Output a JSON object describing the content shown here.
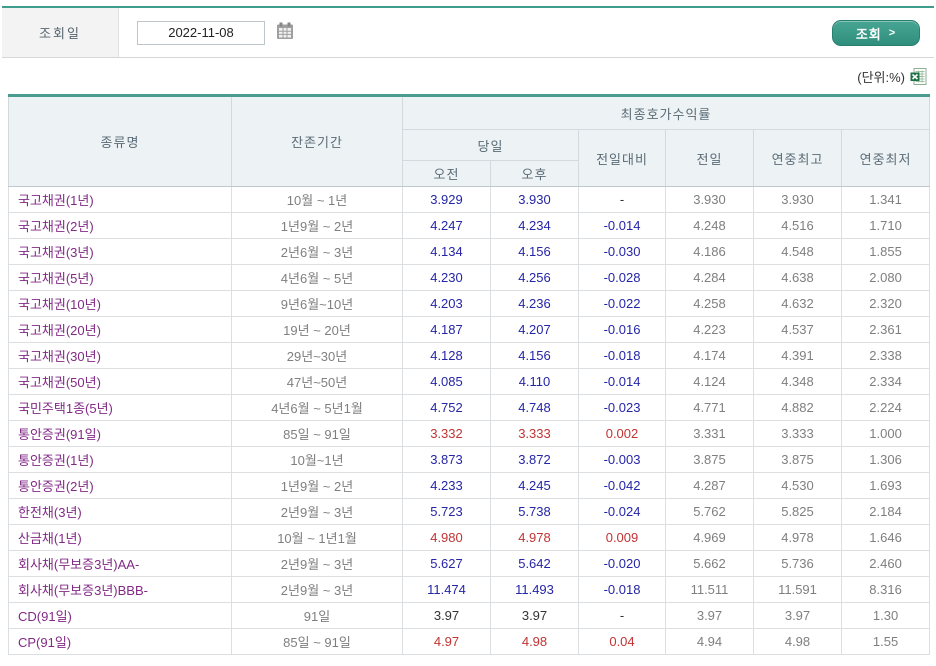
{
  "topbar": {
    "date_label": "조회일",
    "date_value": "2022-11-08",
    "search_button_label": "조회",
    "search_button_chevron": ">"
  },
  "unit_label": "(단위:%)",
  "icons": {
    "calendar": "calendar-icon",
    "excel_export": "excel-icon"
  },
  "colors": {
    "accent_teal": "#3E9D8D",
    "header_bg": "#EDF3F5",
    "name_purple": "#822A86",
    "value_down_blue": "#2525A8",
    "value_up_red": "#C23333",
    "value_gray": "#7F7F7F"
  },
  "table": {
    "header": {
      "name": "종류명",
      "period": "잔존기간",
      "yield_group": "최종호가수익률",
      "today": "당일",
      "am": "오전",
      "pm": "오후",
      "change": "전일대비",
      "prev_day": "전일",
      "year_high": "연중최고",
      "year_low": "연중최저"
    },
    "rows": [
      {
        "name": "국고채권(1년)",
        "period": "10월 ~ 1년",
        "am": "3.929",
        "pm": "3.930",
        "chg": "-",
        "prev": "3.930",
        "high": "3.930",
        "low": "1.341",
        "tone": "down"
      },
      {
        "name": "국고채권(2년)",
        "period": "1년9월 ~ 2년",
        "am": "4.247",
        "pm": "4.234",
        "chg": "-0.014",
        "prev": "4.248",
        "high": "4.516",
        "low": "1.710",
        "tone": "down"
      },
      {
        "name": "국고채권(3년)",
        "period": "2년6월 ~ 3년",
        "am": "4.134",
        "pm": "4.156",
        "chg": "-0.030",
        "prev": "4.186",
        "high": "4.548",
        "low": "1.855",
        "tone": "down"
      },
      {
        "name": "국고채권(5년)",
        "period": "4년6월 ~ 5년",
        "am": "4.230",
        "pm": "4.256",
        "chg": "-0.028",
        "prev": "4.284",
        "high": "4.638",
        "low": "2.080",
        "tone": "down"
      },
      {
        "name": "국고채권(10년)",
        "period": "9년6월~10년",
        "am": "4.203",
        "pm": "4.236",
        "chg": "-0.022",
        "prev": "4.258",
        "high": "4.632",
        "low": "2.320",
        "tone": "down"
      },
      {
        "name": "국고채권(20년)",
        "period": "19년 ~ 20년",
        "am": "4.187",
        "pm": "4.207",
        "chg": "-0.016",
        "prev": "4.223",
        "high": "4.537",
        "low": "2.361",
        "tone": "down"
      },
      {
        "name": "국고채권(30년)",
        "period": "29년~30년",
        "am": "4.128",
        "pm": "4.156",
        "chg": "-0.018",
        "prev": "4.174",
        "high": "4.391",
        "low": "2.338",
        "tone": "down"
      },
      {
        "name": "국고채권(50년)",
        "period": "47년~50년",
        "am": "4.085",
        "pm": "4.110",
        "chg": "-0.014",
        "prev": "4.124",
        "high": "4.348",
        "low": "2.334",
        "tone": "down"
      },
      {
        "name": "국민주택1종(5년)",
        "period": "4년6월 ~ 5년1월",
        "am": "4.752",
        "pm": "4.748",
        "chg": "-0.023",
        "prev": "4.771",
        "high": "4.882",
        "low": "2.224",
        "tone": "down"
      },
      {
        "name": "통안증권(91일)",
        "period": "85일 ~ 91일",
        "am": "3.332",
        "pm": "3.333",
        "chg": "0.002",
        "prev": "3.331",
        "high": "3.333",
        "low": "1.000",
        "tone": "up"
      },
      {
        "name": "통안증권(1년)",
        "period": "10월~1년",
        "am": "3.873",
        "pm": "3.872",
        "chg": "-0.003",
        "prev": "3.875",
        "high": "3.875",
        "low": "1.306",
        "tone": "down"
      },
      {
        "name": "통안증권(2년)",
        "period": "1년9월 ~ 2년",
        "am": "4.233",
        "pm": "4.245",
        "chg": "-0.042",
        "prev": "4.287",
        "high": "4.530",
        "low": "1.693",
        "tone": "down"
      },
      {
        "name": "한전채(3년)",
        "period": "2년9월 ~ 3년",
        "am": "5.723",
        "pm": "5.738",
        "chg": "-0.024",
        "prev": "5.762",
        "high": "5.825",
        "low": "2.184",
        "tone": "down"
      },
      {
        "name": "산금채(1년)",
        "period": "10월 ~ 1년1월",
        "am": "4.980",
        "pm": "4.978",
        "chg": "0.009",
        "prev": "4.969",
        "high": "4.978",
        "low": "1.646",
        "tone": "up"
      },
      {
        "name": "회사채(무보증3년)AA-",
        "period": "2년9월 ~ 3년",
        "am": "5.627",
        "pm": "5.642",
        "chg": "-0.020",
        "prev": "5.662",
        "high": "5.736",
        "low": "2.460",
        "tone": "down"
      },
      {
        "name": "회사채(무보증3년)BBB-",
        "period": "2년9월 ~ 3년",
        "am": "11.474",
        "pm": "11.493",
        "chg": "-0.018",
        "prev": "11.511",
        "high": "11.591",
        "low": "8.316",
        "tone": "down"
      },
      {
        "name": "CD(91일)",
        "period": "91일",
        "am": "3.97",
        "pm": "3.97",
        "chg": "-",
        "prev": "3.97",
        "high": "3.97",
        "low": "1.30",
        "tone": "flat"
      },
      {
        "name": "CP(91일)",
        "period": "85일 ~ 91일",
        "am": "4.97",
        "pm": "4.98",
        "chg": "0.04",
        "prev": "4.94",
        "high": "4.98",
        "low": "1.55",
        "tone": "up"
      }
    ]
  }
}
